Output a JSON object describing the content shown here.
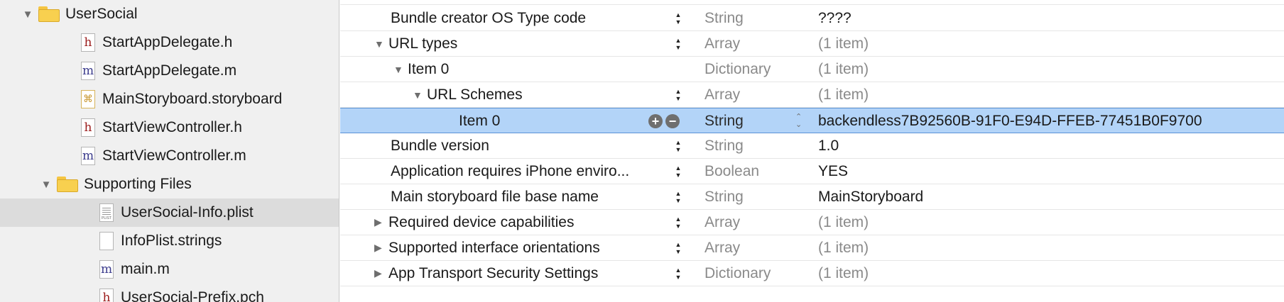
{
  "navigator": {
    "items": [
      {
        "label": "UserSocial",
        "kind": "folder",
        "expanded": true,
        "indent": 0
      },
      {
        "label": "StartAppDelegate.h",
        "kind": "h",
        "icon_glyph": "h",
        "indent": 1
      },
      {
        "label": "StartAppDelegate.m",
        "kind": "m",
        "icon_glyph": "m",
        "indent": 1
      },
      {
        "label": "MainStoryboard.storyboard",
        "kind": "storyboard",
        "icon_glyph": "⌘",
        "indent": 1
      },
      {
        "label": "StartViewController.h",
        "kind": "h",
        "icon_glyph": "h",
        "indent": 1
      },
      {
        "label": "StartViewController.m",
        "kind": "m",
        "icon_glyph": "m",
        "indent": 1
      },
      {
        "label": "Supporting Files",
        "kind": "folder",
        "expanded": true,
        "indent": 1
      },
      {
        "label": "UserSocial-Info.plist",
        "kind": "plist",
        "icon_glyph": "PLIST",
        "indent": 2,
        "selected": true
      },
      {
        "label": "InfoPlist.strings",
        "kind": "strings",
        "icon_glyph": "",
        "indent": 2
      },
      {
        "label": "main.m",
        "kind": "m",
        "icon_glyph": "m",
        "indent": 2
      },
      {
        "label": "UserSocial-Prefix.pch",
        "kind": "h",
        "icon_glyph": "h",
        "indent": 2
      }
    ]
  },
  "plist": {
    "rows": [
      {
        "key": "Bundle creator OS Type code",
        "type": "String",
        "value": "????",
        "level": 0,
        "disclosure": "none",
        "muted_value": false
      },
      {
        "key": "URL types",
        "type": "Array",
        "value": "(1 item)",
        "level": 0,
        "disclosure": "open",
        "muted_value": true
      },
      {
        "key": "Item 0",
        "type": "Dictionary",
        "value": "(1 item)",
        "level": 1,
        "disclosure": "open",
        "muted_value": true,
        "no_stepper": true
      },
      {
        "key": "URL Schemes",
        "type": "Array",
        "value": "(1 item)",
        "level": 2,
        "disclosure": "open",
        "muted_value": true
      },
      {
        "key": "Item 0",
        "type": "String",
        "value": "backendless7B92560B-91F0-E94D-FFEB-77451B0F9700",
        "level": 3,
        "disclosure": "none",
        "muted_value": false,
        "selected": true
      },
      {
        "key": "Bundle version",
        "type": "String",
        "value": "1.0",
        "level": 0,
        "disclosure": "none",
        "muted_value": false
      },
      {
        "key": "Application requires iPhone enviro...",
        "type": "Boolean",
        "value": "YES",
        "level": 0,
        "disclosure": "none",
        "muted_value": false
      },
      {
        "key": "Main storyboard file base name",
        "type": "String",
        "value": "MainStoryboard",
        "level": 0,
        "disclosure": "none",
        "muted_value": false
      },
      {
        "key": "Required device capabilities",
        "type": "Array",
        "value": "(1 item)",
        "level": 0,
        "disclosure": "closed",
        "muted_value": true
      },
      {
        "key": "Supported interface orientations",
        "type": "Array",
        "value": "(1 item)",
        "level": 0,
        "disclosure": "closed",
        "muted_value": true
      },
      {
        "key": "App Transport Security Settings",
        "type": "Dictionary",
        "value": "(1 item)",
        "level": 0,
        "disclosure": "closed",
        "muted_value": true
      }
    ],
    "add_glyph": "+",
    "remove_glyph": "−"
  },
  "colors": {
    "selection": "#b3d4f8",
    "selection_border": "#5b93d6",
    "navigator_bg": "#f0f0f0",
    "navigator_selected": "#dcdcdc",
    "muted_text": "#8a8a8a"
  }
}
